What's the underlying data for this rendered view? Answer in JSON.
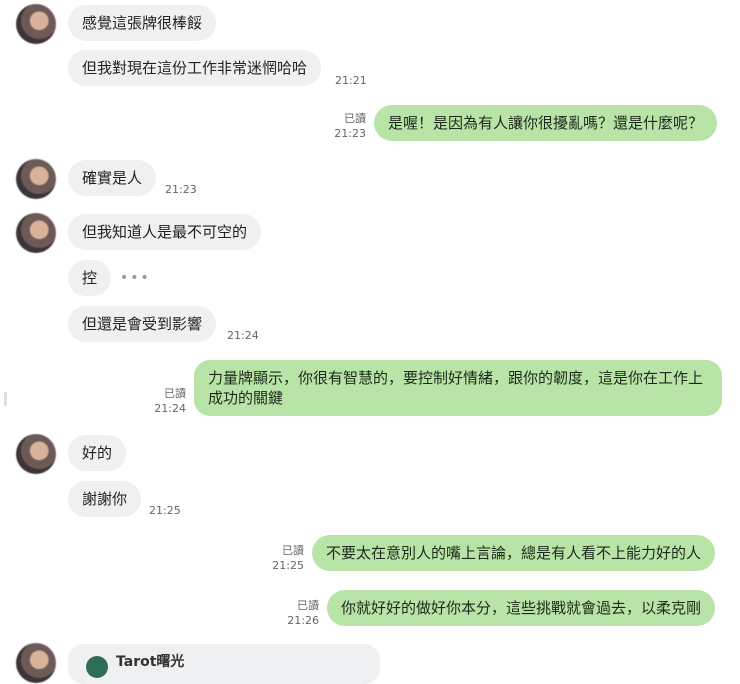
{
  "messages": [
    {
      "text": "感覺這張牌很棒餒"
    },
    {
      "text": "但我對現在這份工作非常迷惘哈哈",
      "time": "21:21"
    },
    {
      "text": "是喔！是因為有人讓你很擾亂嗎？還是什麼呢？",
      "read": "已讀",
      "time": "21:23"
    },
    {
      "text": "確實是人",
      "time": "21:23"
    },
    {
      "text": "但我知道人是最不可空的"
    },
    {
      "text": "控",
      "typing": "•••"
    },
    {
      "text": "但還是會受到影響",
      "time": "21:24"
    },
    {
      "text": "力量牌顯示，你很有智慧的，要控制好情緒，跟你的韌度，這是你在工作上成功的關鍵",
      "read": "已讀",
      "time": "21:24"
    },
    {
      "text": "好的"
    },
    {
      "text": "謝謝你",
      "time": "21:25"
    },
    {
      "text": "不要太在意別人的嘴上言論，總是有人看不上能力好的人",
      "read": "已讀",
      "time": "21:25"
    },
    {
      "text": "你就好好的做好你本分，這些挑戰就會過去，以柔克剛",
      "read": "已讀",
      "time": "21:26"
    }
  ],
  "preview": {
    "title": "Tarot曙光"
  },
  "colors": {
    "incoming": "#eef0f1",
    "outgoing": "#b9e4a8"
  }
}
